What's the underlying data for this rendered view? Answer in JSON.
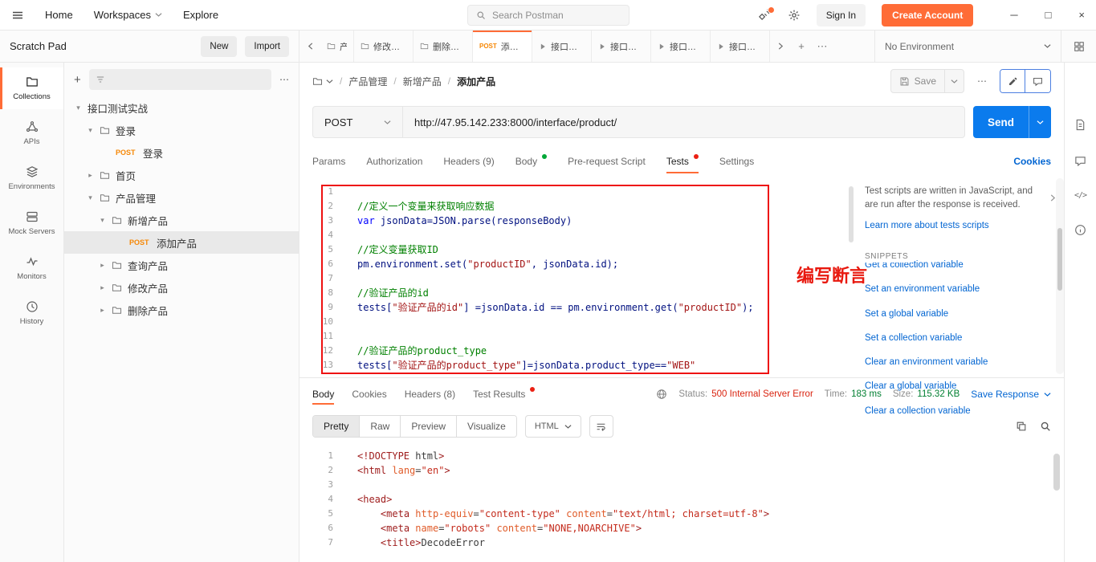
{
  "colors": {
    "brand": "#ff6c37",
    "post": "#f68705",
    "blue": "#0265d2",
    "send": "#0b7bed",
    "err": "#d9230f",
    "ok": "#007f31",
    "red": "#ee1111"
  },
  "topbar": {
    "items": [
      {
        "label": "Home"
      },
      {
        "label": "Workspaces",
        "dropdown": true
      },
      {
        "label": "Explore"
      }
    ],
    "search_placeholder": "Search Postman",
    "sign_in": "Sign In",
    "create_account": "Create Account"
  },
  "workspace": {
    "title": "Scratch Pad",
    "new_label": "New",
    "import_label": "Import"
  },
  "nav_rail": [
    {
      "id": "collections",
      "label": "Collections",
      "active": true
    },
    {
      "id": "apis",
      "label": "APIs"
    },
    {
      "id": "environments",
      "label": "Environments"
    },
    {
      "id": "mock-servers",
      "label": "Mock Servers"
    },
    {
      "id": "monitors",
      "label": "Monitors"
    },
    {
      "id": "history",
      "label": "History"
    }
  ],
  "sidebar_tree": [
    {
      "label": "接口测试实战",
      "type": "collection",
      "depth": 0,
      "expanded": true
    },
    {
      "label": "登录",
      "type": "folder",
      "depth": 1,
      "expanded": true
    },
    {
      "label": "登录",
      "type": "request",
      "method": "POST",
      "depth": 2
    },
    {
      "label": "首页",
      "type": "folder",
      "depth": 1,
      "expanded": false
    },
    {
      "label": "产品管理",
      "type": "folder",
      "depth": 1,
      "expanded": true
    },
    {
      "label": "新增产品",
      "type": "folder",
      "depth": 2,
      "expanded": true
    },
    {
      "label": "添加产品",
      "type": "request",
      "method": "POST",
      "depth": 3,
      "selected": true
    },
    {
      "label": "查询产品",
      "type": "folder",
      "depth": 2,
      "expanded": false
    },
    {
      "label": "修改产品",
      "type": "folder",
      "depth": 2,
      "expanded": false
    },
    {
      "label": "删除产品",
      "type": "folder",
      "depth": 2,
      "expanded": false
    }
  ],
  "tabs": [
    {
      "label": "产品管理",
      "kind": "folder",
      "cut": true
    },
    {
      "label": "修改产品",
      "kind": "folder"
    },
    {
      "label": "删除产品",
      "kind": "folder"
    },
    {
      "label": "添加产品",
      "kind": "request",
      "method": "POST",
      "active": true
    },
    {
      "label": "接口测试实战",
      "kind": "runner"
    },
    {
      "label": "接口测试实战",
      "kind": "runner"
    },
    {
      "label": "接口测试实战",
      "kind": "runner"
    },
    {
      "label": "接口测试实战",
      "kind": "runner"
    }
  ],
  "environment": {
    "selected": "No Environment"
  },
  "breadcrumb": [
    "产品管理",
    "新增产品",
    "添加产品"
  ],
  "request": {
    "method": "POST",
    "url": "http://47.95.142.233:8000/interface/product/",
    "send_label": "Send",
    "save_label": "Save",
    "cookies_link": "Cookies",
    "tabs": [
      {
        "label": "Params"
      },
      {
        "label": "Authorization"
      },
      {
        "label": "Headers",
        "count": "(9)"
      },
      {
        "label": "Body",
        "dot": "green"
      },
      {
        "label": "Pre-request Script"
      },
      {
        "label": "Tests",
        "dot": "red",
        "active": true
      },
      {
        "label": "Settings"
      }
    ]
  },
  "tests_editor": {
    "lines": [
      "",
      "//定义一个变量来获取响应数据",
      "var jsonData=JSON.parse(responseBody)",
      "",
      "//定义变量获取ID",
      "pm.environment.set(\"productID\", jsonData.id);",
      "",
      "//验证产品的id",
      "tests[\"验证产品的id\"] =jsonData.id == pm.environment.get(\"productID\");",
      "",
      "",
      "//验证产品的product_type",
      "tests[\"验证产品的product_type\"]=jsonData.product_type==\"WEB\""
    ],
    "annotation": "编写断言"
  },
  "snippets": {
    "description": "Test scripts are written in JavaScript, and are run after the response is received.",
    "learn_more": "Learn more about tests scripts",
    "heading": "SNIPPETS",
    "items": [
      "Get a collection variable",
      "Set an environment variable",
      "Set a global variable",
      "Set a collection variable",
      "Clear an environment variable",
      "Clear a global variable",
      "Clear a collection variable"
    ]
  },
  "response": {
    "tabs": [
      {
        "label": "Body",
        "active": true
      },
      {
        "label": "Cookies"
      },
      {
        "label": "Headers",
        "count": "(8)"
      },
      {
        "label": "Test Results",
        "dot": "red"
      }
    ],
    "status_label": "Status:",
    "status_value": "500 Internal Server Error",
    "time_label": "Time:",
    "time_value": "183 ms",
    "size_label": "Size:",
    "size_value": "115.32 KB",
    "save_response": "Save Response",
    "view_tabs": [
      {
        "label": "Pretty",
        "active": true
      },
      {
        "label": "Raw"
      },
      {
        "label": "Preview"
      },
      {
        "label": "Visualize"
      }
    ],
    "format": "HTML",
    "body_lines": [
      "<!DOCTYPE html>",
      "<html lang=\"en\">",
      "",
      "<head>",
      "    <meta http-equiv=\"content-type\" content=\"text/html; charset=utf-8\">",
      "    <meta name=\"robots\" content=\"NONE,NOARCHIVE\">",
      "    <title>DecodeError"
    ]
  }
}
